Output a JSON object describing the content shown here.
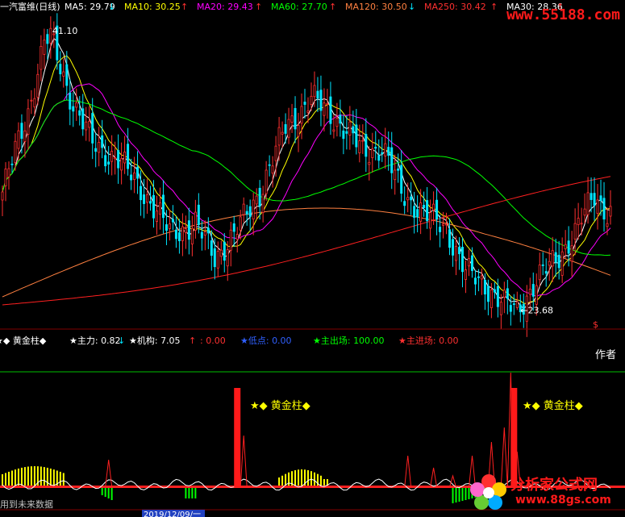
{
  "header": {
    "title": "一汽富维(日线)",
    "ma": [
      {
        "label": "MA5: 29.79",
        "arrow": "↓",
        "color": "#ffffff"
      },
      {
        "label": "MA10: 30.25",
        "arrow": "↑",
        "color": "#ffff00"
      },
      {
        "label": "MA20: 29.43",
        "arrow": "↑",
        "color": "#ff00ff"
      },
      {
        "label": "MA60: 27.70",
        "arrow": "↑",
        "color": "#00ff00"
      },
      {
        "label": "MA120: 30.50",
        "arrow": "↓",
        "color": "#ff8040"
      },
      {
        "label": "MA250: 30.42",
        "arrow": "↑",
        "color": "#ff3030"
      },
      {
        "label": "MA30: 28.36",
        "arrow": "↑",
        "color": "#ffffff"
      }
    ]
  },
  "watermark": "www.55188.com",
  "indicator_header": [
    {
      "label": "★◆ 黄金柱◆",
      "color": "#ffffff"
    },
    {
      "label": "★主力: 0.82",
      "arrow": "↓",
      "color": "#ffffff"
    },
    {
      "label": "★机构: 7.05",
      "arrow": "↑",
      "color": "#ffffff"
    },
    {
      "label": ": 0.00",
      "color": "#ff3030"
    },
    {
      "label": "★低点: 0.00",
      "color": "#3060ff"
    },
    {
      "label": "★主出场: 100.00",
      "color": "#00ff00"
    },
    {
      "label": "★主进场: 0.00",
      "color": "#ff3030"
    }
  ],
  "author_label": "作者",
  "annotations": {
    "high": "41.10",
    "low": "←23.68",
    "dollar": "$",
    "golden1": "★◆  黄金柱◆",
    "golden2": "★◆  黄金柱◆"
  },
  "footer": {
    "left": "用到未来数据",
    "date": "2019/12/09/一"
  },
  "logo": {
    "line1": "分析家公式网",
    "line2": "www.88gs.com"
  },
  "colors": {
    "up": "#ff3030",
    "down": "#00e5ff",
    "ma5": "#ffffff",
    "ma10": "#ffff00",
    "ma20": "#ff00ff",
    "ma60": "#00ff00",
    "ma120": "#ff8040",
    "ma250": "#ff2020"
  },
  "chart_data": [
    {
      "type": "line",
      "title": "一汽富维(日线)",
      "ylim": [
        23.0,
        42.0
      ],
      "annotated_high": 41.1,
      "annotated_low": 23.68,
      "price_key_points": [
        {
          "i": 0,
          "v": 31.0
        },
        {
          "i": 8,
          "v": 36.0
        },
        {
          "i": 14,
          "v": 41.1
        },
        {
          "i": 22,
          "v": 36.5
        },
        {
          "i": 28,
          "v": 34.0
        },
        {
          "i": 36,
          "v": 33.0
        },
        {
          "i": 44,
          "v": 31.0
        },
        {
          "i": 52,
          "v": 28.5
        },
        {
          "i": 60,
          "v": 29.0
        },
        {
          "i": 66,
          "v": 27.0
        },
        {
          "i": 72,
          "v": 28.3
        },
        {
          "i": 80,
          "v": 31.0
        },
        {
          "i": 88,
          "v": 35.0
        },
        {
          "i": 96,
          "v": 36.8
        },
        {
          "i": 104,
          "v": 35.5
        },
        {
          "i": 112,
          "v": 33.5
        },
        {
          "i": 118,
          "v": 33.8
        },
        {
          "i": 124,
          "v": 31.0
        },
        {
          "i": 132,
          "v": 29.5
        },
        {
          "i": 138,
          "v": 28.8
        },
        {
          "i": 144,
          "v": 26.0
        },
        {
          "i": 150,
          "v": 25.3
        },
        {
          "i": 156,
          "v": 24.0
        },
        {
          "i": 160,
          "v": 23.68
        },
        {
          "i": 166,
          "v": 25.5
        },
        {
          "i": 172,
          "v": 26.8
        },
        {
          "i": 178,
          "v": 28.5
        },
        {
          "i": 184,
          "v": 30.8
        },
        {
          "i": 188,
          "v": 29.8
        }
      ],
      "series": [
        {
          "name": "MA5",
          "value": 29.79
        },
        {
          "name": "MA10",
          "value": 30.25
        },
        {
          "name": "MA20",
          "value": 29.43
        },
        {
          "name": "MA60",
          "value": 27.7
        },
        {
          "name": "MA120",
          "value": 30.5
        },
        {
          "name": "MA250",
          "value": 30.42
        },
        {
          "name": "MA30",
          "value": 28.36
        }
      ]
    },
    {
      "type": "bar",
      "title": "黄金柱",
      "series": [
        {
          "name": "主力",
          "value": 0.82
        },
        {
          "name": "机构",
          "value": 7.05
        },
        {
          "name": "低点",
          "value": 0.0
        },
        {
          "name": "主出场",
          "value": 100.0
        },
        {
          "name": "主进场",
          "value": 0.0
        }
      ],
      "golden_bar_indices": [
        73,
        159
      ]
    }
  ]
}
